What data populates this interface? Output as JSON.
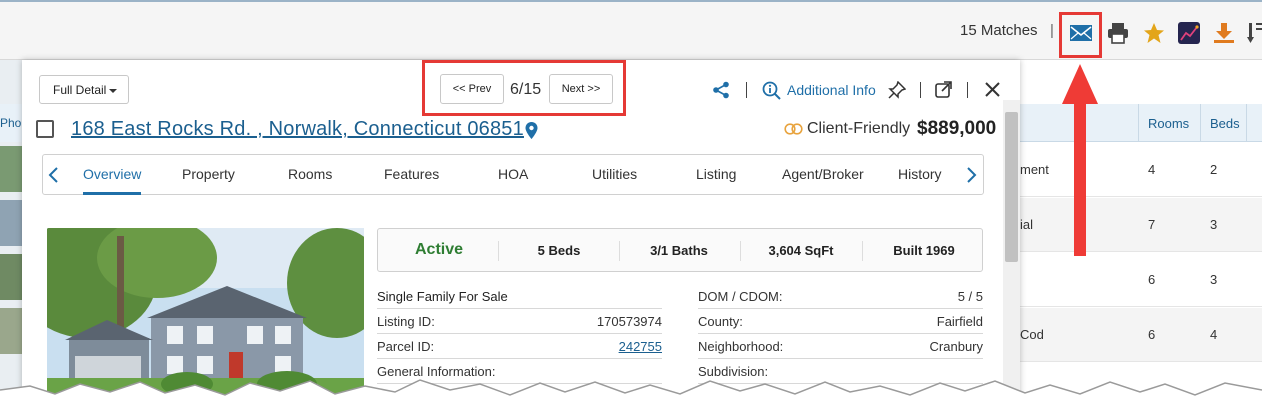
{
  "toolbar": {
    "matches": "15 Matches",
    "separator": "|",
    "icons": [
      "email-icon",
      "print-icon",
      "star-icon",
      "chart-icon",
      "download-icon",
      "sort-icon"
    ],
    "colors": {
      "email": "#1f6fa8",
      "star": "#e3a51a",
      "download": "#e07b1f",
      "highlight": "#e53935"
    }
  },
  "background_table": {
    "headers": [
      "Rooms",
      "Beds"
    ],
    "left_header": "Pho",
    "rows": [
      {
        "style": "ment",
        "rooms": "4",
        "beds": "2"
      },
      {
        "style": "ial",
        "rooms": "7",
        "beds": "3"
      },
      {
        "style": "",
        "rooms": "6",
        "beds": "3"
      },
      {
        "style": "Cod",
        "rooms": "6",
        "beds": "4"
      }
    ]
  },
  "detail": {
    "view_select": "Full Detail",
    "prev_label": "<< Prev",
    "next_label": "Next >>",
    "position": "6/15",
    "additional_info": "Additional Info",
    "address": "168 East Rocks Rd. , Norwalk, Connecticut 06851",
    "client_friendly": "Client-Friendly",
    "price": "$889,000",
    "tabs": [
      "Overview",
      "Property",
      "Rooms",
      "Features",
      "HOA",
      "Utilities",
      "Listing",
      "Agent/Broker",
      "History"
    ],
    "active_tab": "Overview",
    "stats": {
      "status": "Active",
      "beds": "5 Beds",
      "baths": "3/1 Baths",
      "sqft": "3,604 SqFt",
      "built": "Built 1969"
    },
    "left_info": {
      "type": "Single Family For Sale",
      "listing_id_label": "Listing ID:",
      "listing_id": "170573974",
      "parcel_id_label": "Parcel ID:",
      "parcel_id": "242755",
      "general_label": "General Information:"
    },
    "right_info": {
      "dom_label": "DOM / CDOM:",
      "dom": "5 / 5",
      "county_label": "County:",
      "county": "Fairfield",
      "neighborhood_label": "Neighborhood:",
      "neighborhood": "Cranbury",
      "subdivision_label": "Subdivision:"
    }
  }
}
